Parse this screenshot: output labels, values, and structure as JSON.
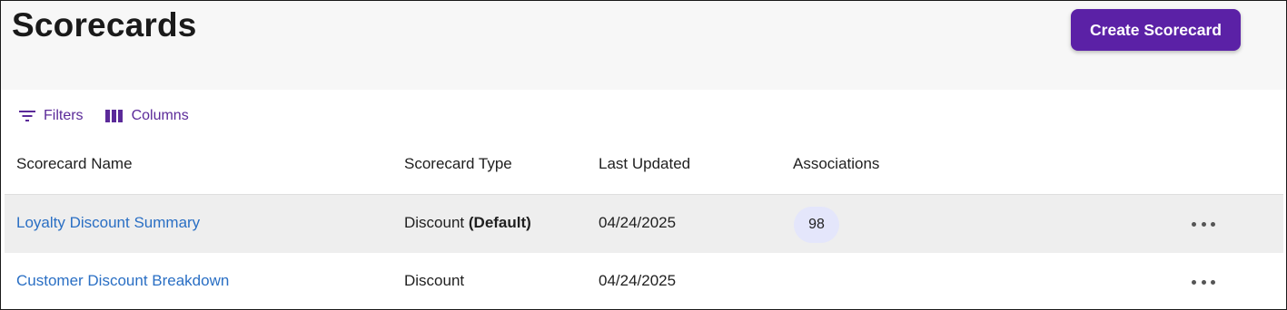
{
  "header": {
    "title": "Scorecards",
    "create_label": "Create Scorecard"
  },
  "toolbar": {
    "filters_label": "Filters",
    "filters_icon": "filter-icon",
    "columns_label": "Columns",
    "columns_icon": "columns-icon"
  },
  "table": {
    "columns": [
      "Scorecard Name",
      "Scorecard Type",
      "Last Updated",
      "Associations"
    ],
    "rows": [
      {
        "name": "Loyalty Discount Summary",
        "type": "Discount",
        "type_tag": "(Default)",
        "last_updated": "04/24/2025",
        "associations": "98",
        "more_icon": "more-horizontal-icon"
      },
      {
        "name": "Customer Discount Breakdown",
        "type": "Discount",
        "type_tag": "",
        "last_updated": "04/24/2025",
        "associations": "",
        "more_icon": "more-horizontal-icon"
      }
    ]
  },
  "colors": {
    "primary": "#5b21a6",
    "link": "#2a6fc4",
    "badge_bg": "#e4e6fb",
    "row_highlight": "#eeeeee",
    "header_bg": "#f7f7f7"
  }
}
